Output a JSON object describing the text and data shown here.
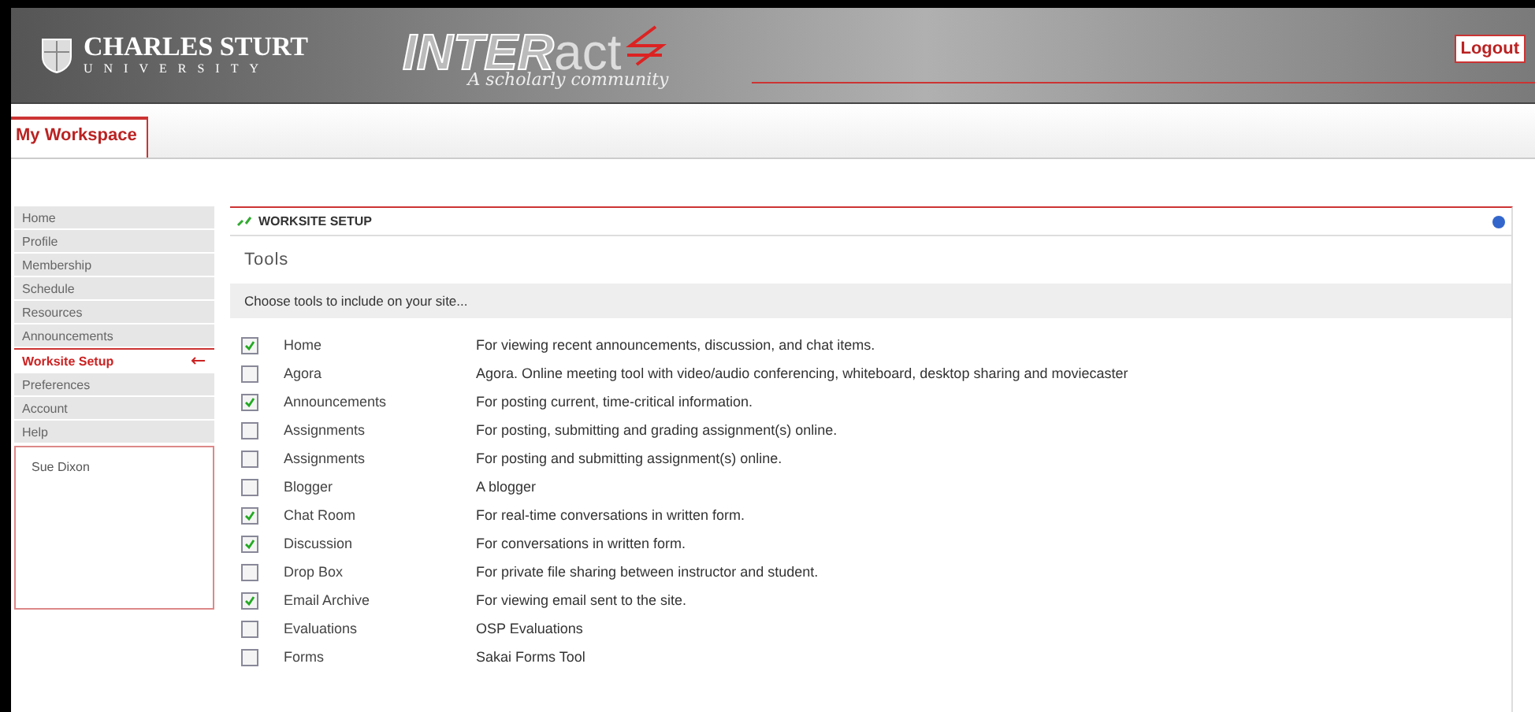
{
  "header": {
    "university_name": "CHARLES STURT",
    "university_sub": "UNIVERSITY",
    "logo_bold": "INTER",
    "logo_light": "act",
    "tagline": "A scholarly community",
    "logout": "Logout"
  },
  "tabs": [
    {
      "label": "My Workspace",
      "selected": true
    }
  ],
  "sidebar": {
    "items": [
      {
        "label": "Home",
        "selected": false
      },
      {
        "label": "Profile",
        "selected": false
      },
      {
        "label": "Membership",
        "selected": false
      },
      {
        "label": "Schedule",
        "selected": false
      },
      {
        "label": "Resources",
        "selected": false
      },
      {
        "label": "Announcements",
        "selected": false
      },
      {
        "label": "Worksite Setup",
        "selected": true
      },
      {
        "label": "Preferences",
        "selected": false
      },
      {
        "label": "Account",
        "selected": false
      },
      {
        "label": "Help",
        "selected": false
      }
    ],
    "user": "Sue Dixon"
  },
  "panel": {
    "title": "WORKSITE SETUP",
    "heading": "Tools",
    "instruction": "Choose tools to include on your site...",
    "tools": [
      {
        "name": "Home",
        "description": "For viewing recent announcements, discussion, and chat items.",
        "checked": true
      },
      {
        "name": "Agora",
        "description": "Agora. Online meeting tool with video/audio conferencing, whiteboard, desktop sharing and moviecaster",
        "checked": false
      },
      {
        "name": "Announcements",
        "description": "For posting current, time-critical information.",
        "checked": true
      },
      {
        "name": "Assignments",
        "description": "For posting, submitting and grading assignment(s) online.",
        "checked": false
      },
      {
        "name": "Assignments",
        "description": "For posting and submitting assignment(s) online.",
        "checked": false
      },
      {
        "name": "Blogger",
        "description": "A blogger",
        "checked": false
      },
      {
        "name": "Chat Room",
        "description": "For real-time conversations in written form.",
        "checked": true
      },
      {
        "name": "Discussion",
        "description": "For conversations in written form.",
        "checked": true
      },
      {
        "name": "Drop Box",
        "description": "For private file sharing between instructor and student.",
        "checked": false
      },
      {
        "name": "Email Archive",
        "description": "For viewing email sent to the site.",
        "checked": true
      },
      {
        "name": "Evaluations",
        "description": "OSP Evaluations",
        "checked": false
      },
      {
        "name": "Forms",
        "description": "Sakai Forms Tool",
        "checked": false
      }
    ]
  }
}
